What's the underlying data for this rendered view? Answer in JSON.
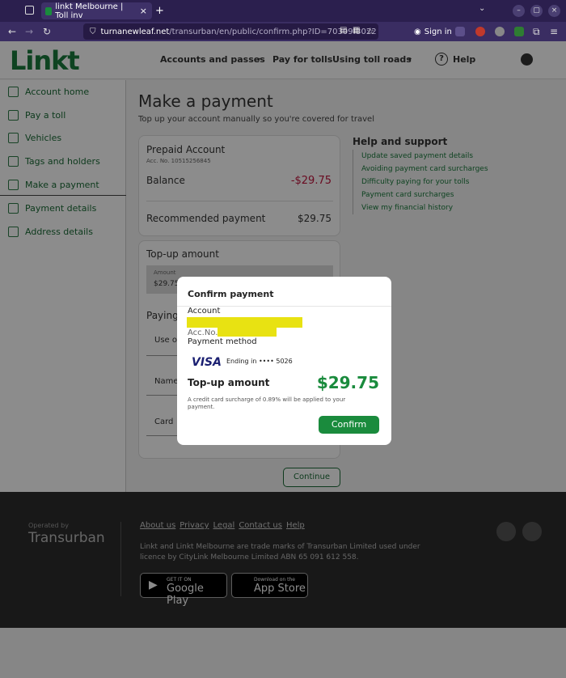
{
  "browser": {
    "tab_title": "linkt Melbourne | Toll inv",
    "tab_close": "×",
    "new_tab": "+",
    "url_host": "turnanewleaf.net",
    "url_path": "/transurban/en/public/confirm.php?ID=70309f3022",
    "signin": "Sign in",
    "chevron": "⌄",
    "min": "–",
    "max": "▢",
    "close": "×"
  },
  "header": {
    "logo": "Linkt",
    "nav": [
      "Accounts and passes",
      "Pay for tolls",
      "Using toll roads"
    ],
    "help": "Help"
  },
  "sidebar": {
    "items": [
      "Account home",
      "Pay a toll",
      "Vehicles",
      "Tags and holders",
      "Make a payment",
      "Payment details",
      "Address details"
    ]
  },
  "main": {
    "title": "Make a payment",
    "subtitle": "Top up your account manually so you're covered for travel",
    "prepaid": {
      "title": "Prepaid Account",
      "acc_no": "Acc. No. 10515256845",
      "balance_label": "Balance",
      "balance_value": "-$29.75",
      "rec_label": "Recommended payment",
      "rec_value": "$29.75"
    },
    "topup": {
      "title": "Top-up amount",
      "amount_label": "Amount",
      "amount_value": "$29.75"
    },
    "paying": {
      "title": "Paying",
      "row1": "Use of",
      "row2": "Name",
      "row3": "Card"
    },
    "continue": "Continue"
  },
  "help": {
    "title": "Help and support",
    "links": [
      "Update saved payment details",
      "Avoiding payment card surcharges",
      "Difficulty paying for your tolls",
      "Payment card surcharges",
      "View my financial history"
    ]
  },
  "footer": {
    "operated_by": "Operated by",
    "brand": "Transurban",
    "links": [
      "About us",
      "Privacy",
      "Legal",
      "Contact us",
      "Help"
    ],
    "copyright": "Linkt and Linkt Melbourne are trade marks of Transurban Limited used under licence by CityLink Melbourne Limited ABN 65 091 612 558.",
    "google_top": "GET IT ON",
    "google_name": "Google Play",
    "apple_top": "Download on the",
    "apple_name": "App Store"
  },
  "modal": {
    "title": "Confirm payment",
    "account_label": "Account",
    "acc_no_label": "Acc.No.",
    "payment_method_label": "Payment method",
    "card_brand": "VISA",
    "ending": "Ending in •••• 5026",
    "topup_label": "Top-up amount",
    "topup_value": "$29.75",
    "surcharge": "A credit card surcharge of 0.89% will be applied to your payment.",
    "confirm": "Confirm"
  }
}
